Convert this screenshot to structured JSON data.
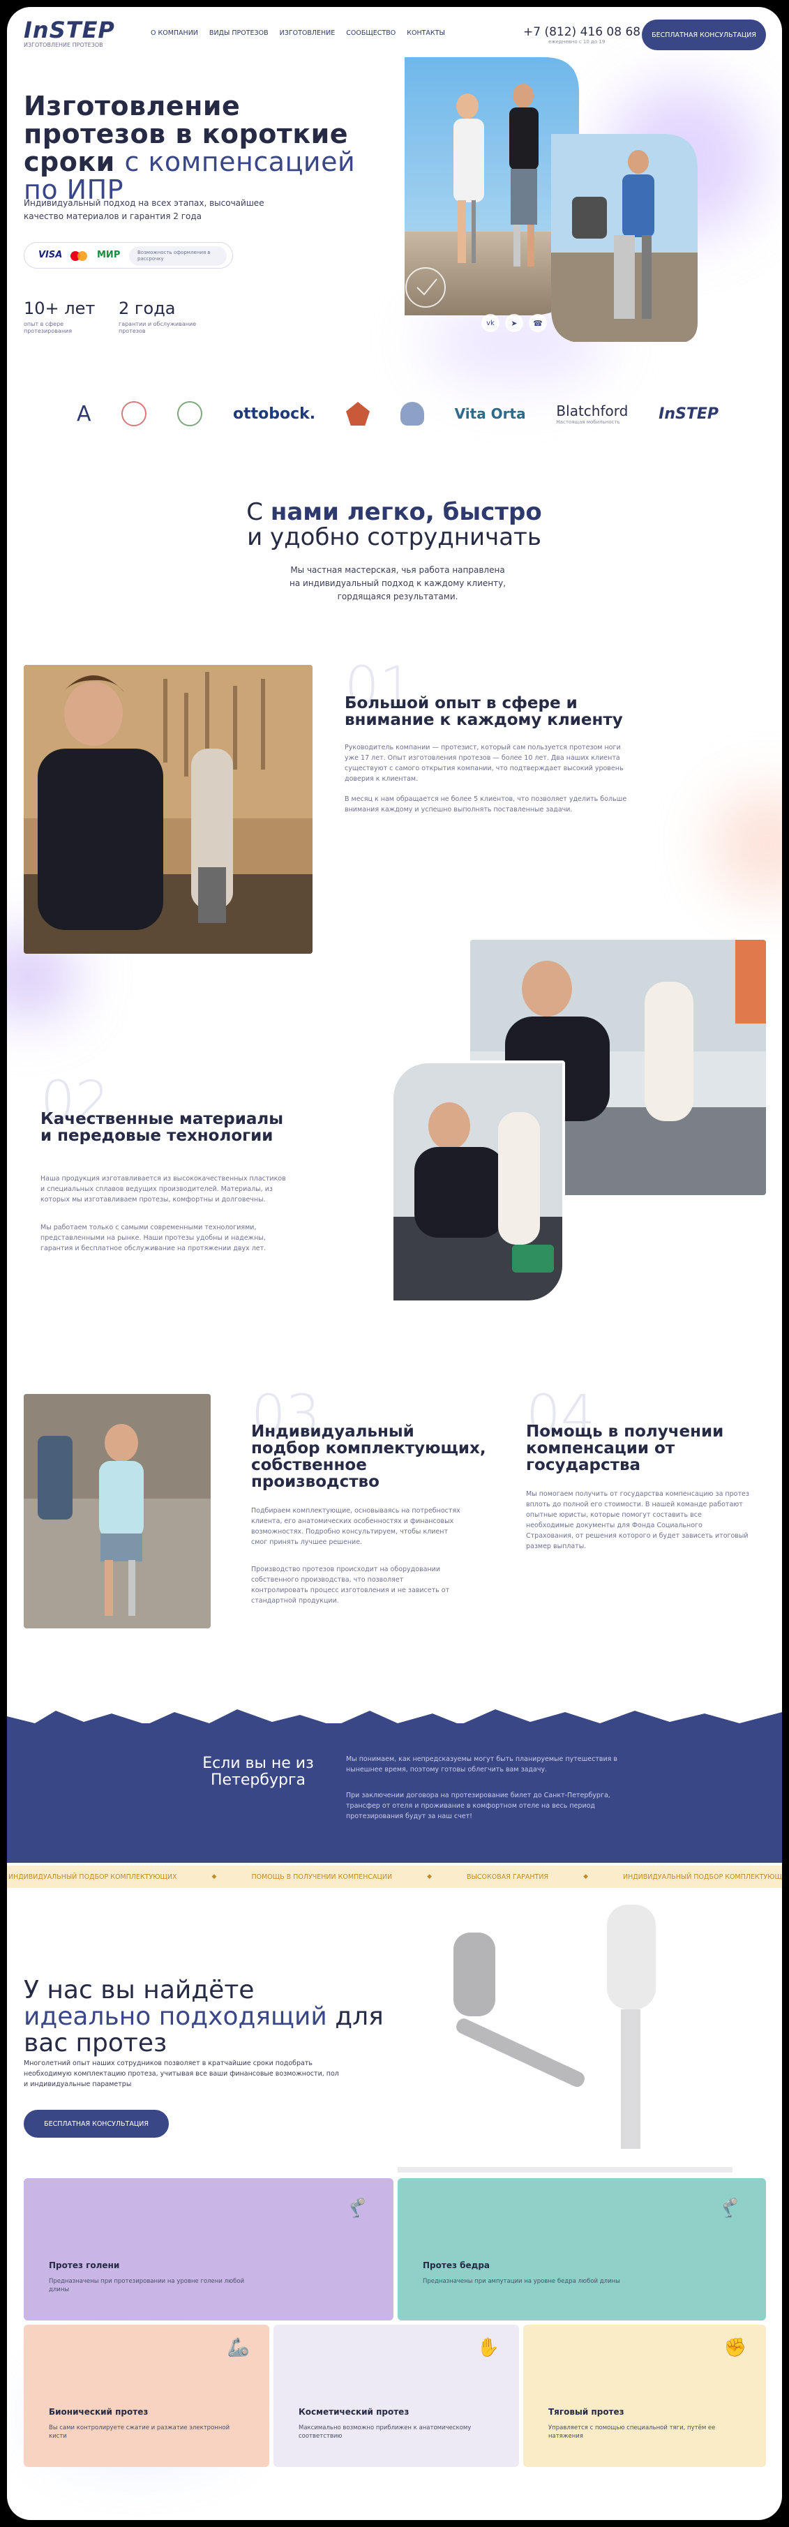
{
  "header": {
    "logo": "InSTEP",
    "logo_sub": "ИЗГОТОВЛЕНИЕ ПРОТЕЗОВ",
    "nav": [
      "О КОМПАНИИ",
      "ВИДЫ ПРОТЕЗОВ",
      "ИЗГОТОВЛЕНИЕ",
      "СООБЩЕСТВО",
      "КОНТАКТЫ"
    ],
    "phone": "+7 (812) 416 08 68",
    "phone_note": "ежедневно с 10 до 19",
    "cta": "БЕСПЛАТНАЯ КОНСУЛЬТАЦИЯ"
  },
  "hero": {
    "title_1": "Изготовление протезов в короткие сроки",
    "title_2": "с компенсацией по ИПР",
    "subtitle": "Индивидуальный подход на всех этапах, высочайшее качество материалов и гарантия 2 года",
    "payment": {
      "visa": "VISA",
      "mir": "МИР",
      "note": "Возможность оформления в рассрочку"
    },
    "stats": [
      {
        "value": "10+ лет",
        "caption": "опыт в сфере протезирования"
      },
      {
        "value": "2 года",
        "caption": "гарантии и обслуживание протезов"
      }
    ],
    "social_icons": [
      "vk-icon",
      "telegram-icon",
      "whatsapp-icon"
    ]
  },
  "partners": [
    "A",
    "ottobock.",
    "Vita Orta",
    "Blatchford",
    "InSTEP"
  ],
  "partners_sub": {
    "blatchford": "Настоящая мобильность"
  },
  "about": {
    "title_light_1": "С ",
    "title_bold": "нами легко, быстро",
    "title_light_2": " и удобно сотрудничать",
    "text": "Мы частная мастерская, чья работа направлена на индивидуальный подход к каждому клиенту, гордящаяся результатами."
  },
  "features": [
    {
      "num": "01",
      "title": "Большой опыт в сфере и внимание к каждому клиенту",
      "text_1": "Руководитель компании — протезист, который сам пользуется протезом ноги уже 17 лет. Опыт изготовления протезов — более 10 лет. Два наших клиента существуют с самого открытия компании, что подтверждает высокий уровень доверия к клиентам.",
      "text_2": "В месяц к нам обращается не более 5 клиентов, что позволяет уделить больше внимания каждому и успешно выполнять поставленные задачи."
    },
    {
      "num": "02",
      "title": "Качественные материалы и передовые технологии",
      "text_1": "Наша продукция изготавливается из высококачественных пластиков и специальных сплавов ведущих производителей. Материалы, из которых мы изготавливаем протезы, комфортны и долговечны.",
      "text_2": "Мы работаем только с самыми современными технологиями, представленными на рынке. Наши протезы удобны и надежны, гарантия и бесплатное обслуживание на протяжении двух лет."
    },
    {
      "num": "03",
      "title": "Индивидуальный подбор комплектующих, собственное производство",
      "text_1": "Подбираем комплектующие, основываясь на потребностях клиента, его анатомических особенностях и финансовых возможностях. Подробно консультируем, чтобы клиент смог принять лучшее решение.",
      "text_2": "Производство протезов происходит на оборудовании собственного производства, что позволяет контролировать процесс изготовления и не зависеть от стандартной продукции."
    },
    {
      "num": "04",
      "title": "Помощь в получении компенсации от государства",
      "text_1": "Мы помогаем получить от государства компенсацию за протез вплоть до полной его стоимости. В нашей команде работают опытные юристы, которые помогут составить все необходимые документы для Фонда Социального Страхования, от решения которого и будет зависеть итоговый размер выплаты."
    }
  ],
  "region": {
    "title": "Если вы не из Петербурга",
    "text_1": "Мы понимаем, как непредсказуемы могут быть планируемые путешествия в нынешнее время, поэтому готовы облегчить вам задачу.",
    "text_2": "При заключении договора на протезирование билет до Санкт-Петербурга, трансфер от отеля и проживание в комфортном отеле на весь период протезирования будут за наш счет!"
  },
  "ticker": [
    "ИНДИВИДУАЛЬНЫЙ ПОДБОР КОМПЛЕКТУЮЩИХ",
    "ПОМОЩЬ В ПОЛУЧЕНИИ КОМПЕНСАЦИИ",
    "ВЫСОКОВАЯ ГАРАНТИЯ",
    "ИНДИВИДУАЛЬНЫЙ ПОДБОР КОМПЛЕКТУЮЩИХ"
  ],
  "products": {
    "title_1": "У нас вы найдёте ",
    "title_2": "идеально подходящий",
    "title_3": " для вас протез",
    "text": "Многолетний опыт наших сотрудников позволяет в кратчайшие сроки подобрать необходимую комплектацию протеза, учитывая все ваши финансовые возможности, пол и индивидуальные параметры",
    "cta": "БЕСПЛАТНАЯ КОНСУЛЬТАЦИЯ",
    "cards": [
      {
        "title": "Протез голени",
        "desc": "Предназначены при протезировании на уровне голени любой длины",
        "color": "#c9b5e6"
      },
      {
        "title": "Протез бедра",
        "desc": "Предназначены при ампутации на уровне бедра любой длины",
        "color": "#8fd0c8"
      },
      {
        "title": "Бионический протез",
        "desc": "Вы сами контролируете сжатие и разжатие электронной кисти",
        "color": "#f8d3c1"
      },
      {
        "title": "Косметический протез",
        "desc": "Максимально возможно приближен к анатомическому соответствию",
        "color": "#edeaf6"
      },
      {
        "title": "Тяговый протез",
        "desc": "Управляется с помощью специальной тяги, путём ее натяжения",
        "color": "#fbecc8"
      }
    ]
  }
}
